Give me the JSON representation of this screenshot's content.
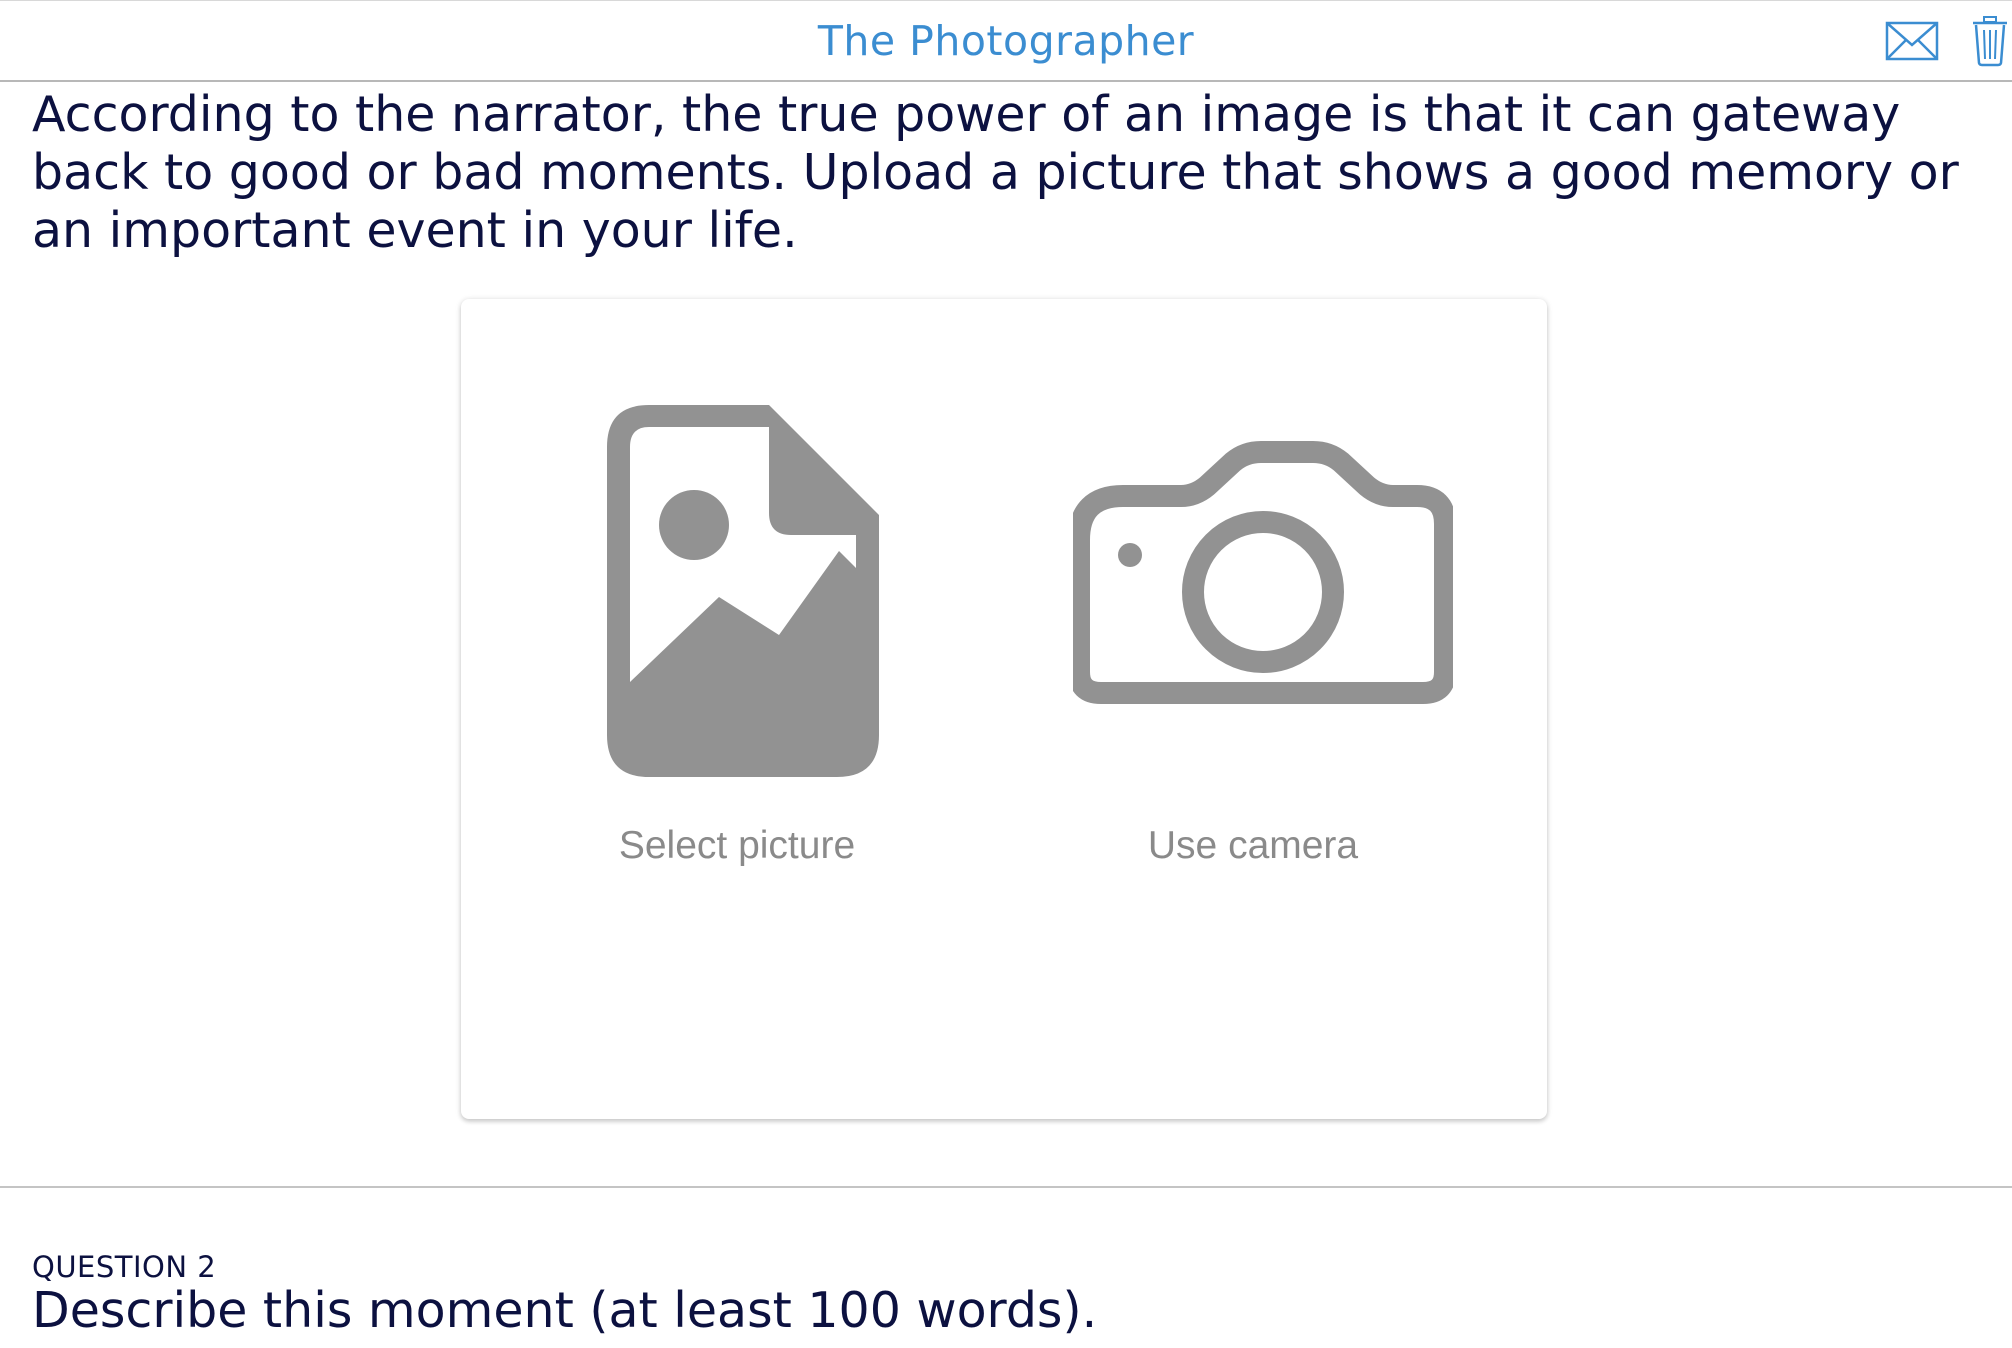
{
  "header": {
    "title": "The Photographer",
    "mail_icon": "mail-icon",
    "trash_icon": "trash-icon"
  },
  "prompt": {
    "text": "According to the narrator, the true power of an image is that it can gateway back to good or bad moments. Upload a picture that shows a good memory or an important event in your life."
  },
  "upload": {
    "select_label": "Select picture",
    "select_icon": "image-file-icon",
    "camera_label": "Use camera",
    "camera_icon": "camera-icon",
    "icon_color": "#929292"
  },
  "question": {
    "number": "QUESTION 2",
    "text": "Describe this moment (at least 100 words)."
  },
  "colors": {
    "title": "#3b8dd1",
    "text": "#0c1140",
    "label": "#8a8a8a"
  }
}
